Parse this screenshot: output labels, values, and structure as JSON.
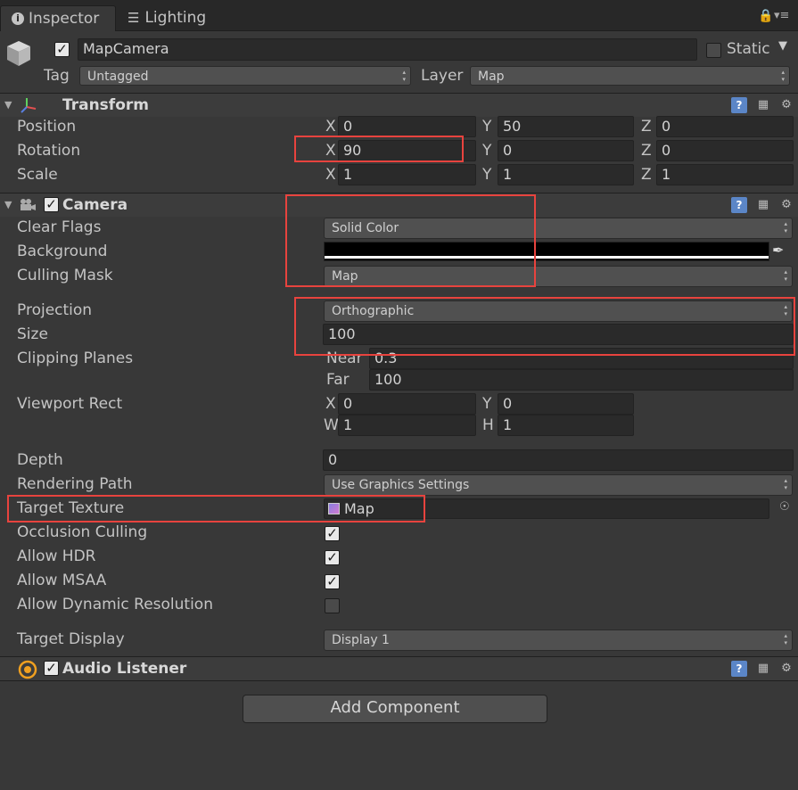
{
  "tabs": {
    "inspector": "Inspector",
    "lighting": "Lighting"
  },
  "object": {
    "name": "MapCamera",
    "static_label": "Static",
    "tag_label": "Tag",
    "tag_value": "Untagged",
    "layer_label": "Layer",
    "layer_value": "Map"
  },
  "transform": {
    "title": "Transform",
    "position": {
      "label": "Position",
      "x": "0",
      "y": "50",
      "z": "0"
    },
    "rotation": {
      "label": "Rotation",
      "x": "90",
      "y": "0",
      "z": "0"
    },
    "scale": {
      "label": "Scale",
      "x": "1",
      "y": "1",
      "z": "1"
    }
  },
  "camera": {
    "title": "Camera",
    "clear_flags": {
      "label": "Clear Flags",
      "value": "Solid Color"
    },
    "background": {
      "label": "Background",
      "color": "#000000"
    },
    "culling_mask": {
      "label": "Culling Mask",
      "value": "Map"
    },
    "projection": {
      "label": "Projection",
      "value": "Orthographic"
    },
    "size": {
      "label": "Size",
      "value": "100"
    },
    "clipping": {
      "label": "Clipping Planes",
      "near_label": "Near",
      "near": "0.3",
      "far_label": "Far",
      "far": "100"
    },
    "viewport": {
      "label": "Viewport Rect",
      "x": "0",
      "y": "0",
      "w": "1",
      "h": "1"
    },
    "depth": {
      "label": "Depth",
      "value": "0"
    },
    "rendering_path": {
      "label": "Rendering Path",
      "value": "Use Graphics Settings"
    },
    "target_texture": {
      "label": "Target Texture",
      "value": "Map"
    },
    "occlusion_culling": {
      "label": "Occlusion Culling",
      "checked": true
    },
    "allow_hdr": {
      "label": "Allow HDR",
      "checked": true
    },
    "allow_msaa": {
      "label": "Allow MSAA",
      "checked": true
    },
    "allow_dynamic_resolution": {
      "label": "Allow Dynamic Resolution",
      "checked": false
    },
    "target_display": {
      "label": "Target Display",
      "value": "Display 1"
    }
  },
  "audio_listener": {
    "title": "Audio Listener"
  },
  "add_component": "Add Component",
  "axes": {
    "x": "X",
    "y": "Y",
    "z": "Z",
    "w": "W",
    "h": "H"
  },
  "colors": {
    "background": "#383838",
    "highlight": "#e8433e",
    "help": "#5b86c7"
  },
  "icons": [
    "info-icon",
    "lighting-icon",
    "lock-icon",
    "menu-icon",
    "cube-icon",
    "transform-icon",
    "camera-icon",
    "audio-listener-icon",
    "help-icon",
    "preset-icon",
    "gear-icon",
    "eyedropper-icon",
    "texture-icon",
    "object-picker-icon"
  ]
}
